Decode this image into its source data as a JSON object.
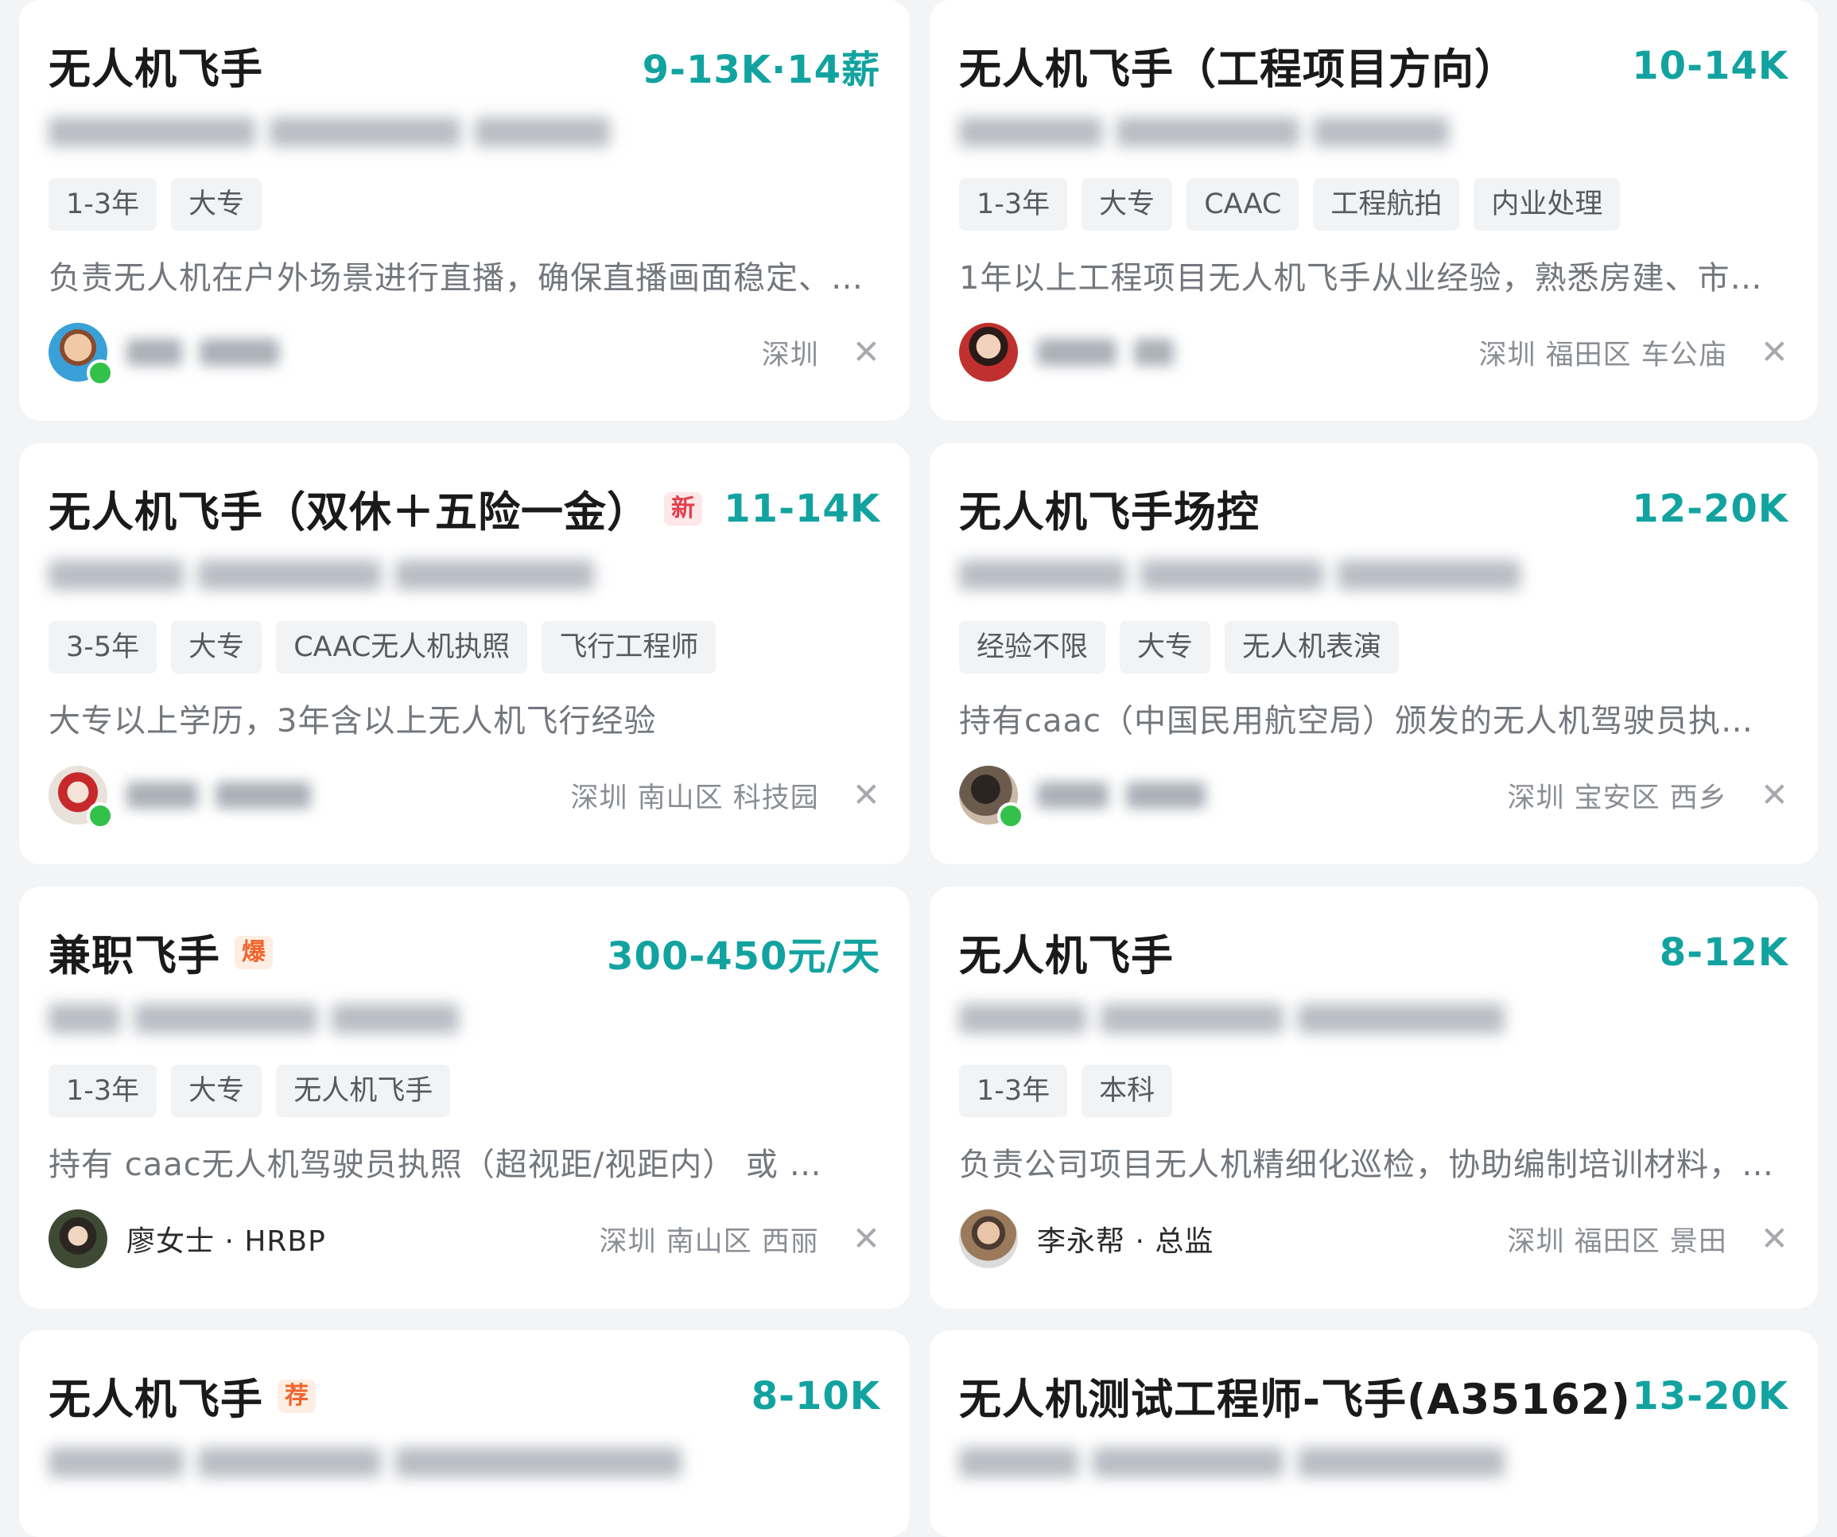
{
  "jobs": [
    {
      "title": "无人机飞手",
      "badge": "",
      "salary": "9-13K·14薪",
      "tags": [
        "1-3年",
        "大专"
      ],
      "desc": "负责无人机在户外场景进行直播，确保直播画面稳定、…",
      "recruiter": "",
      "location": "深圳",
      "avatar_color": "#3aa0d8",
      "online": true
    },
    {
      "title": "无人机飞手（工程项目方向）",
      "badge": "",
      "salary": "10-14K",
      "tags": [
        "1-3年",
        "大专",
        "CAAC",
        "工程航拍",
        "内业处理"
      ],
      "desc": "1年以上工程项目无人机飞手从业经验，熟悉房建、市…",
      "recruiter": "",
      "location": "深圳 福田区 车公庙",
      "avatar_color": "#c0302e",
      "online": false
    },
    {
      "title": "无人机飞手（双休＋五险一金）",
      "badge": "新",
      "salary": "11-14K",
      "tags": [
        "3-5年",
        "大专",
        "CAAC无人机执照",
        "飞行工程师"
      ],
      "desc": "大专以上学历，3年含以上无人机飞行经验",
      "recruiter": "",
      "location": "深圳 南山区 科技园",
      "avatar_color": "#c7282c",
      "online": true
    },
    {
      "title": "无人机飞手场控",
      "badge": "",
      "salary": "12-20K",
      "tags": [
        "经验不限",
        "大专",
        "无人机表演"
      ],
      "desc": "持有caac（中国民用航空局）颁发的无人机驾驶员执…",
      "recruiter": "",
      "location": "深圳 宝安区 西乡",
      "avatar_color": "#4a4038",
      "online": true
    },
    {
      "title": "兼职飞手",
      "badge": "爆",
      "salary": "300-450元/天",
      "tags": [
        "1-3年",
        "大专",
        "无人机飞手"
      ],
      "desc": "持有 caac无人机驾驶员执照（超视距/视距内） 或 …",
      "recruiter": "廖女士 · HRBP",
      "location": "深圳 南山区 西丽",
      "avatar_color": "#3f4a35",
      "online": false
    },
    {
      "title": "无人机飞手",
      "badge": "",
      "salary": "8-12K",
      "tags": [
        "1-3年",
        "本科"
      ],
      "desc": "负责公司项目无人机精细化巡检，协助编制培训材料，…",
      "recruiter": "李永帮 · 总监",
      "location": "深圳 福田区 景田",
      "avatar_color": "#b07a4a",
      "online": false
    },
    {
      "title": "无人机飞手",
      "badge": "荐",
      "salary": "8-10K"
    },
    {
      "title": "无人机测试工程师-飞手(A35162)",
      "badge": "",
      "salary": "13-20K"
    }
  ],
  "close_icon": "close-icon",
  "accent_color": "#12a3a0"
}
